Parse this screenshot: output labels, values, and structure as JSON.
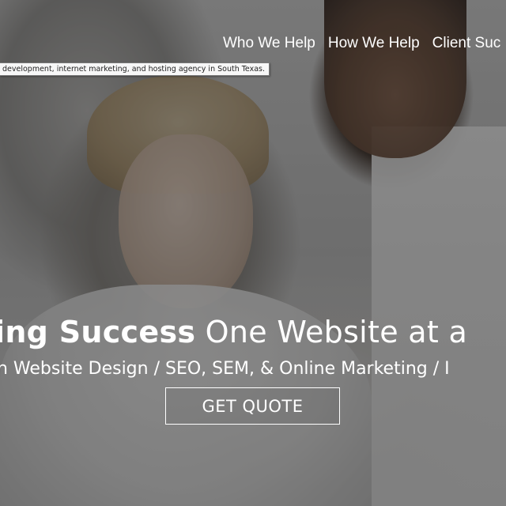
{
  "nav": {
    "items": [
      {
        "label": "Who We Help"
      },
      {
        "label": "How We Help"
      },
      {
        "label": "Client Suc"
      }
    ]
  },
  "tooltip": {
    "text": "development, internet marketing, and hosting agency in South Texas."
  },
  "hero": {
    "headline_strong": "ing Success",
    "headline_light": " One Website at a",
    "subline": "n Website Design / SEO, SEM, & Online Marketing / I",
    "cta_label": "GET QUOTE"
  },
  "colors": {
    "overlay": "rgba(0,0,0,0.42)",
    "text": "#ffffff"
  }
}
